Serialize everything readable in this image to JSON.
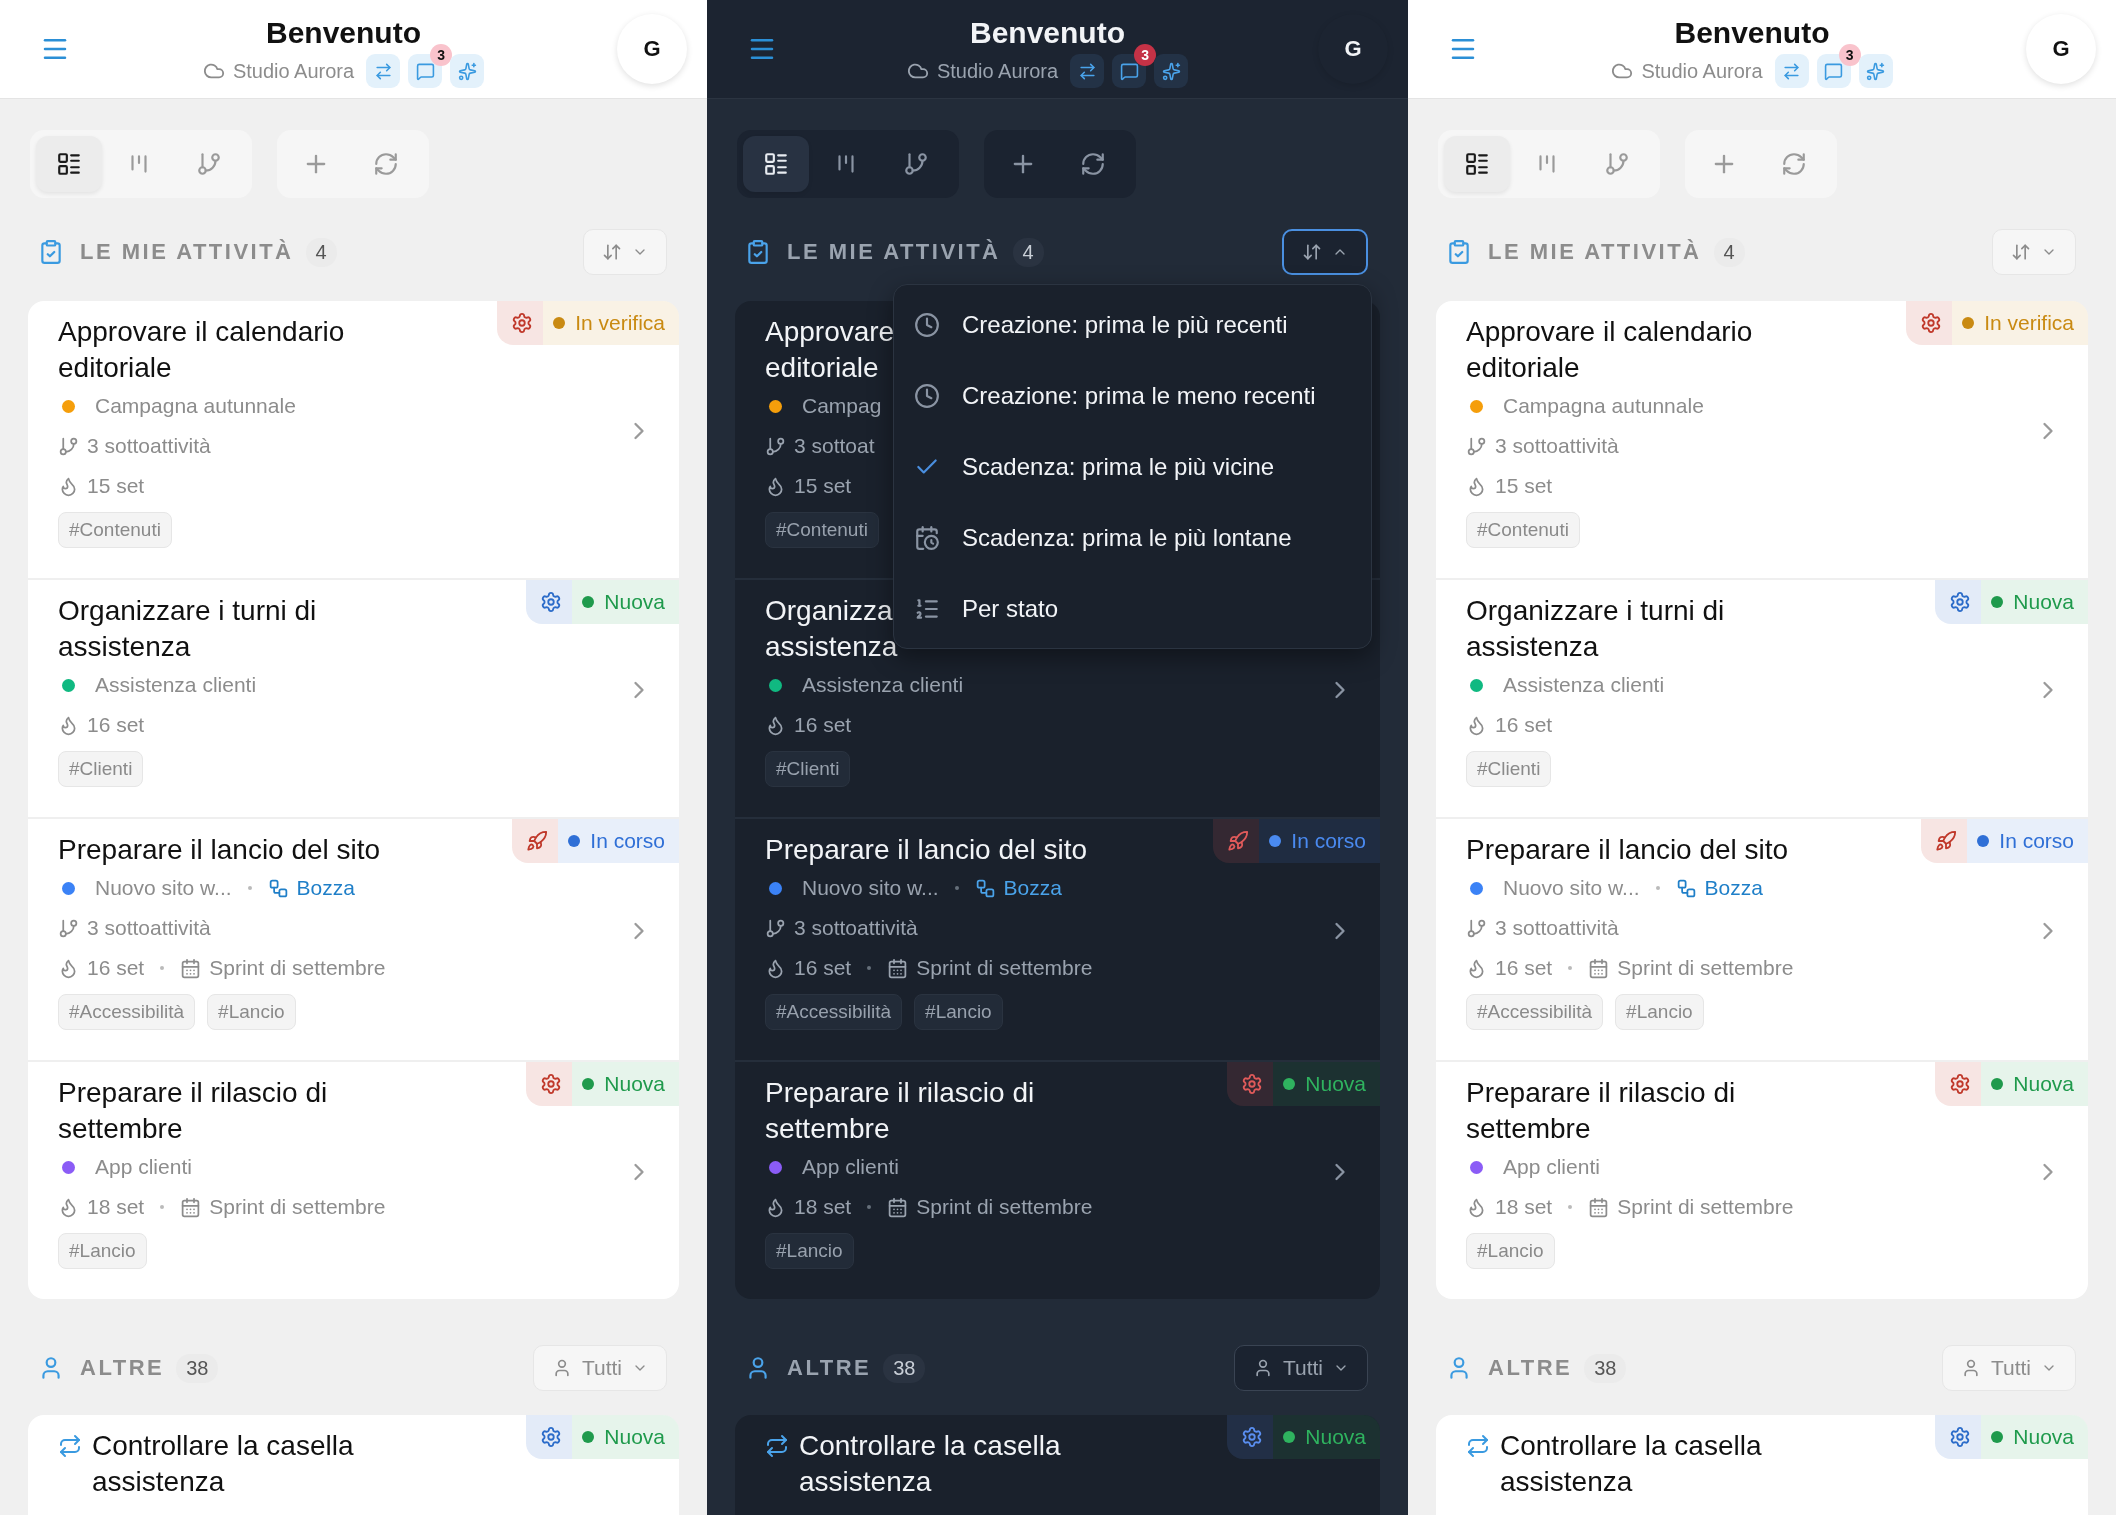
{
  "screens": [
    {
      "dark": false,
      "header": {
        "title": "Benvenuto",
        "workspace": "Studio Aurora",
        "notifications": "3",
        "avatar": "G"
      },
      "views": [
        {
          "kind": "list",
          "selected": true
        },
        {
          "kind": "board",
          "selected": false
        },
        {
          "kind": "tree",
          "selected": false
        }
      ],
      "sections": [
        {
          "kind": "mine",
          "title": "LE MIE ATTIVITÀ",
          "count": "4",
          "sort_open": false,
          "tasks": [
            {
              "title": "Approvare il calendario editoriale",
              "recurring": false,
              "kind": "task",
              "urgent": true,
              "status": {
                "label": "In verifica",
                "color": "#c98a12"
              },
              "project": {
                "name": "Campagna autunnale",
                "color": "#f59e0b"
              },
              "subtasks": "3 sottoattività",
              "due": "15 set",
              "tags": [
                "#Contenuti"
              ],
              "chevron": true
            },
            {
              "title": "Organizzare i turni di assistenza",
              "recurring": false,
              "kind": "task",
              "urgent": false,
              "status": {
                "label": "Nuova",
                "color": "#1f9a4c"
              },
              "project": {
                "name": "Assistenza clienti",
                "color": "#10b981"
              },
              "due": "16 set",
              "tags": [
                "#Clienti"
              ],
              "chevron": true
            },
            {
              "title": "Preparare il lancio del sito",
              "recurring": false,
              "kind": "milestone",
              "urgent": true,
              "status": {
                "label": "In corso",
                "color": "#2f6fd6"
              },
              "project": {
                "name": "Nuovo sito w...",
                "color": "#3b82f6"
              },
              "draft": "Bozza",
              "subtasks": "3 sottoattività",
              "due": "16 set",
              "sprint": "Sprint di settembre",
              "tags": [
                "#Accessibilità",
                "#Lancio"
              ],
              "chevron": true
            },
            {
              "title": "Preparare il rilascio di settembre",
              "recurring": false,
              "kind": "task",
              "urgent": true,
              "status": {
                "label": "Nuova",
                "color": "#1f9a4c"
              },
              "project": {
                "name": "App clienti",
                "color": "#8b5cf6"
              },
              "due": "18 set",
              "sprint": "Sprint di settembre",
              "tags": [
                "#Lancio"
              ],
              "chevron": true
            }
          ]
        },
        {
          "kind": "others",
          "title": "ALTRE",
          "count": "38",
          "filter": "Tutti",
          "tasks": [
            {
              "title": "Controllare la casella assistenza",
              "recurring": true,
              "kind": "task",
              "urgent": false,
              "status": {
                "label": "Nuova",
                "color": "#1f9a4c"
              },
              "chevron": false
            }
          ]
        }
      ]
    },
    {
      "dark": true,
      "header": {
        "title": "Benvenuto",
        "workspace": "Studio Aurora",
        "notifications": "3",
        "avatar": "G"
      },
      "views": [
        {
          "kind": "list",
          "selected": true
        },
        {
          "kind": "board",
          "selected": false
        },
        {
          "kind": "tree",
          "selected": false
        }
      ],
      "sections": [
        {
          "kind": "mine",
          "title": "LE MIE ATTIVITÀ",
          "count": "4",
          "sort_open": true,
          "sort_options": [
            {
              "kind": "created",
              "label": "Creazione: prima le più recenti",
              "selected": false
            },
            {
              "kind": "created",
              "label": "Creazione: prima le meno recenti",
              "selected": false
            },
            {
              "kind": "due",
              "label": "Scadenza: prima le più vicine",
              "selected": true
            },
            {
              "kind": "due",
              "label": "Scadenza: prima le più lontane",
              "selected": false
            },
            {
              "kind": "status",
              "label": "Per stato",
              "selected": false
            }
          ],
          "tasks": [
            {
              "title": "Approvare\neditoriale",
              "recurring": false,
              "project": {
                "name": "Campag",
                "color": "#f59e0b"
              },
              "subtasks": "3 sottoat",
              "due": "15 set",
              "tags": [
                "#Contenuti"
              ],
              "chevron": false
            },
            {
              "title": "Organizza\nassistenza",
              "recurring": false,
              "project": {
                "name": "Assistenza clienti",
                "color": "#10b981"
              },
              "due": "16 set",
              "tags": [
                "#Clienti"
              ],
              "chevron": true
            },
            {
              "title": "Preparare il lancio del sito",
              "recurring": false,
              "kind": "milestone",
              "urgent": true,
              "status": {
                "label": "In corso",
                "color": "#4a8af0"
              },
              "project": {
                "name": "Nuovo sito w...",
                "color": "#3b82f6"
              },
              "draft": "Bozza",
              "subtasks": "3 sottoattività",
              "due": "16 set",
              "sprint": "Sprint di settembre",
              "tags": [
                "#Accessibilità",
                "#Lancio"
              ],
              "chevron": true
            },
            {
              "title": "Preparare il rilascio di settembre",
              "recurring": false,
              "kind": "task",
              "urgent": true,
              "status": {
                "label": "Nuova",
                "color": "#2fb35f"
              },
              "project": {
                "name": "App clienti",
                "color": "#8b5cf6"
              },
              "due": "18 set",
              "sprint": "Sprint di settembre",
              "tags": [
                "#Lancio"
              ],
              "chevron": true
            }
          ]
        },
        {
          "kind": "others",
          "title": "ALTRE",
          "count": "38",
          "filter": "Tutti",
          "tasks": [
            {
              "title": "Controllare la casella assistenza",
              "recurring": true,
              "kind": "task",
              "urgent": false,
              "status": {
                "label": "Nuova",
                "color": "#2fb35f"
              },
              "chevron": false
            }
          ]
        }
      ]
    },
    {
      "dark": false,
      "header": {
        "title": "Benvenuto",
        "workspace": "Studio Aurora",
        "notifications": "3",
        "avatar": "G"
      },
      "views": [
        {
          "kind": "list",
          "selected": true
        },
        {
          "kind": "board",
          "selected": false
        },
        {
          "kind": "tree",
          "selected": false
        }
      ],
      "sections": [
        {
          "kind": "mine",
          "title": "LE MIE ATTIVITÀ",
          "count": "4",
          "sort_open": false,
          "tasks": [
            {
              "title": "Approvare il calendario editoriale",
              "recurring": false,
              "kind": "task",
              "urgent": true,
              "status": {
                "label": "In verifica",
                "color": "#c98a12"
              },
              "project": {
                "name": "Campagna autunnale",
                "color": "#f59e0b"
              },
              "subtasks": "3 sottoattività",
              "due": "15 set",
              "tags": [
                "#Contenuti"
              ],
              "chevron": true
            },
            {
              "title": "Organizzare i turni di assistenza",
              "recurring": false,
              "kind": "task",
              "urgent": false,
              "status": {
                "label": "Nuova",
                "color": "#1f9a4c"
              },
              "project": {
                "name": "Assistenza clienti",
                "color": "#10b981"
              },
              "due": "16 set",
              "tags": [
                "#Clienti"
              ],
              "chevron": true
            },
            {
              "title": "Preparare il lancio del sito",
              "recurring": false,
              "kind": "milestone",
              "urgent": true,
              "status": {
                "label": "In corso",
                "color": "#2f6fd6"
              },
              "project": {
                "name": "Nuovo sito w...",
                "color": "#3b82f6"
              },
              "draft": "Bozza",
              "subtasks": "3 sottoattività",
              "due": "16 set",
              "sprint": "Sprint di settembre",
              "tags": [
                "#Accessibilità",
                "#Lancio"
              ],
              "chevron": true
            },
            {
              "title": "Preparare il rilascio di settembre",
              "recurring": false,
              "kind": "task",
              "urgent": true,
              "status": {
                "label": "Nuova",
                "color": "#1f9a4c"
              },
              "project": {
                "name": "App clienti",
                "color": "#8b5cf6"
              },
              "due": "18 set",
              "sprint": "Sprint di settembre",
              "tags": [
                "#Lancio"
              ],
              "chevron": true
            }
          ]
        },
        {
          "kind": "others",
          "title": "ALTRE",
          "count": "38",
          "filter": "Tutti",
          "tasks": [
            {
              "title": "Controllare la casella assistenza",
              "recurring": true,
              "kind": "task",
              "urgent": false,
              "status": {
                "label": "Nuova",
                "color": "#1f9a4c"
              },
              "chevron": false
            }
          ]
        }
      ]
    }
  ]
}
